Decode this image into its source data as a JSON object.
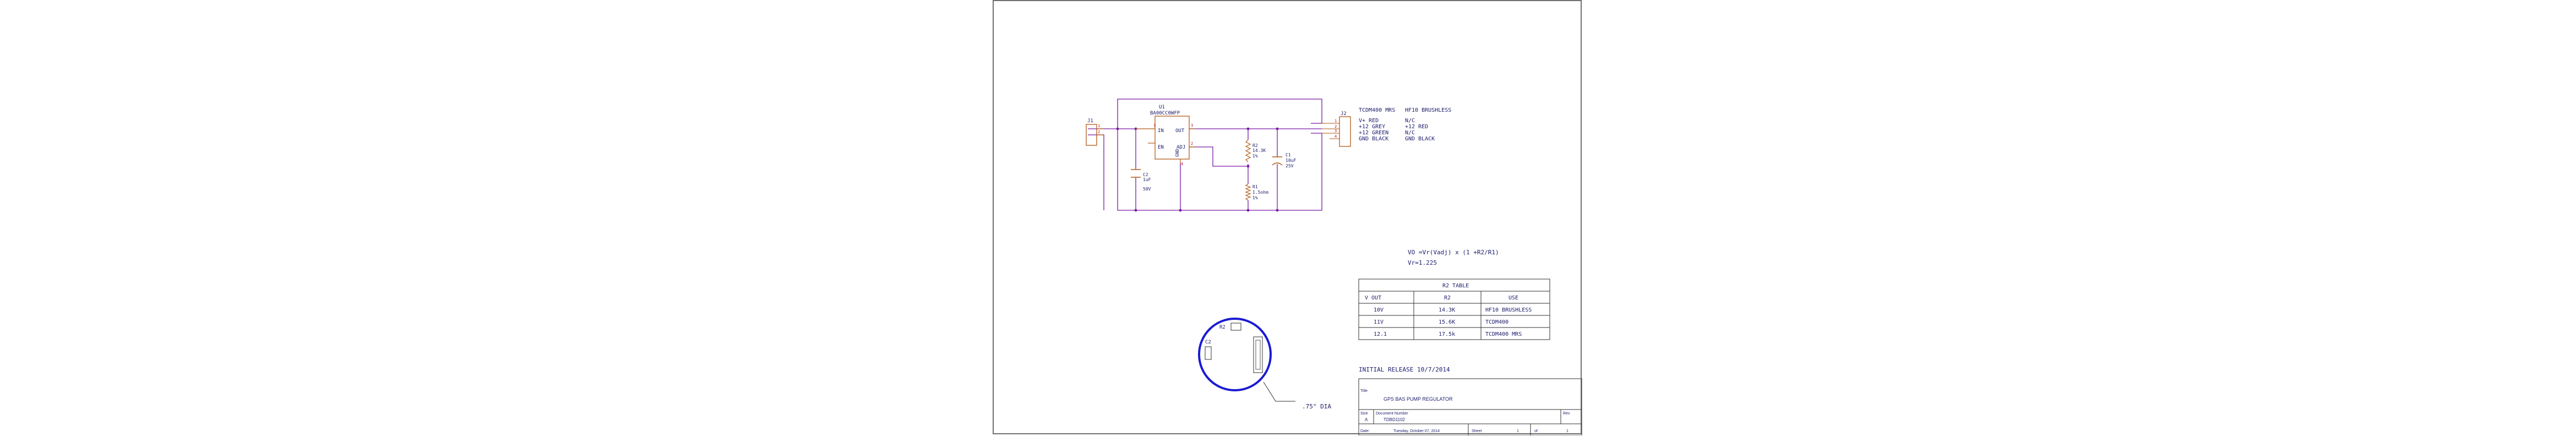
{
  "schematic": {
    "connector_left": {
      "ref": "J1",
      "pins": [
        "1",
        "2"
      ]
    },
    "regulator": {
      "ref": "U1",
      "part": "BA00CC0WFP",
      "pins": {
        "in": "IN",
        "out": "OUT",
        "adj": "ADJ",
        "gnd": "GND",
        "en": "EN"
      },
      "pin_numbers": [
        "1",
        "3",
        "2",
        "4"
      ]
    },
    "c2": {
      "ref": "C2",
      "value": "1uF",
      "voltage": "50V"
    },
    "r2": {
      "ref": "R2",
      "value": "14.3K",
      "tol": "1%"
    },
    "r1": {
      "ref": "R1",
      "value": "1.5ohm",
      "tol": "1%"
    },
    "c1": {
      "ref": "C1",
      "value": "10uF",
      "voltage": "25V"
    },
    "connector_right": {
      "ref": "J2",
      "pins": [
        "1",
        "2",
        "3",
        "4"
      ]
    }
  },
  "wiring_table": {
    "header": [
      "TCDM400 MRS",
      "HF10 BRUSHLESS"
    ],
    "rows": [
      [
        "V+  RED",
        "N/C"
      ],
      [
        "+12 GREY",
        "+12 RED"
      ],
      [
        "+12 GREEN",
        "N/C"
      ],
      [
        "GND BLACK",
        "GND BLACK"
      ]
    ]
  },
  "formula": {
    "line1": "VO =Vr(Vadj) x (1 +R2/R1)",
    "line2": "Vr=1.225"
  },
  "r2_table": {
    "title": "R2 TABLE",
    "columns": [
      "V OUT",
      "R2",
      "USE"
    ],
    "rows": [
      [
        "10V",
        "14.3K",
        "HF10 BRUSHLESS"
      ],
      [
        "11V",
        "15.6K",
        "TCDM400"
      ],
      [
        "12.1",
        "17.5k",
        "TCDM400 MRS"
      ]
    ]
  },
  "board": {
    "labels": {
      "r2": "R2",
      "c2": "C2"
    },
    "diameter_label": ".75\" DIA",
    "outline_color": "#1a1ad4"
  },
  "release_note": "INITIAL RELEASE 10/7/2014",
  "title_block": {
    "title_label": "Title",
    "title_value": "GPS BAS PUMP REGULATOR",
    "size_label": "Size",
    "size_value": "A",
    "docnum_label": "Document Number",
    "docnum_value": "TDBD1102",
    "rev_label": "Rev",
    "rev_value": "",
    "date_label": "Date:",
    "date_value": "Tuesday, October 07, 2014",
    "sheet_label": "Sheet",
    "sheet_value": "1",
    "of_label": "of",
    "of_value": "1"
  },
  "colors": {
    "wire": "#7a1aa8",
    "component": "#b05a18",
    "text": "#1c1c6c",
    "pin": "#c01010",
    "table": "#303030"
  }
}
